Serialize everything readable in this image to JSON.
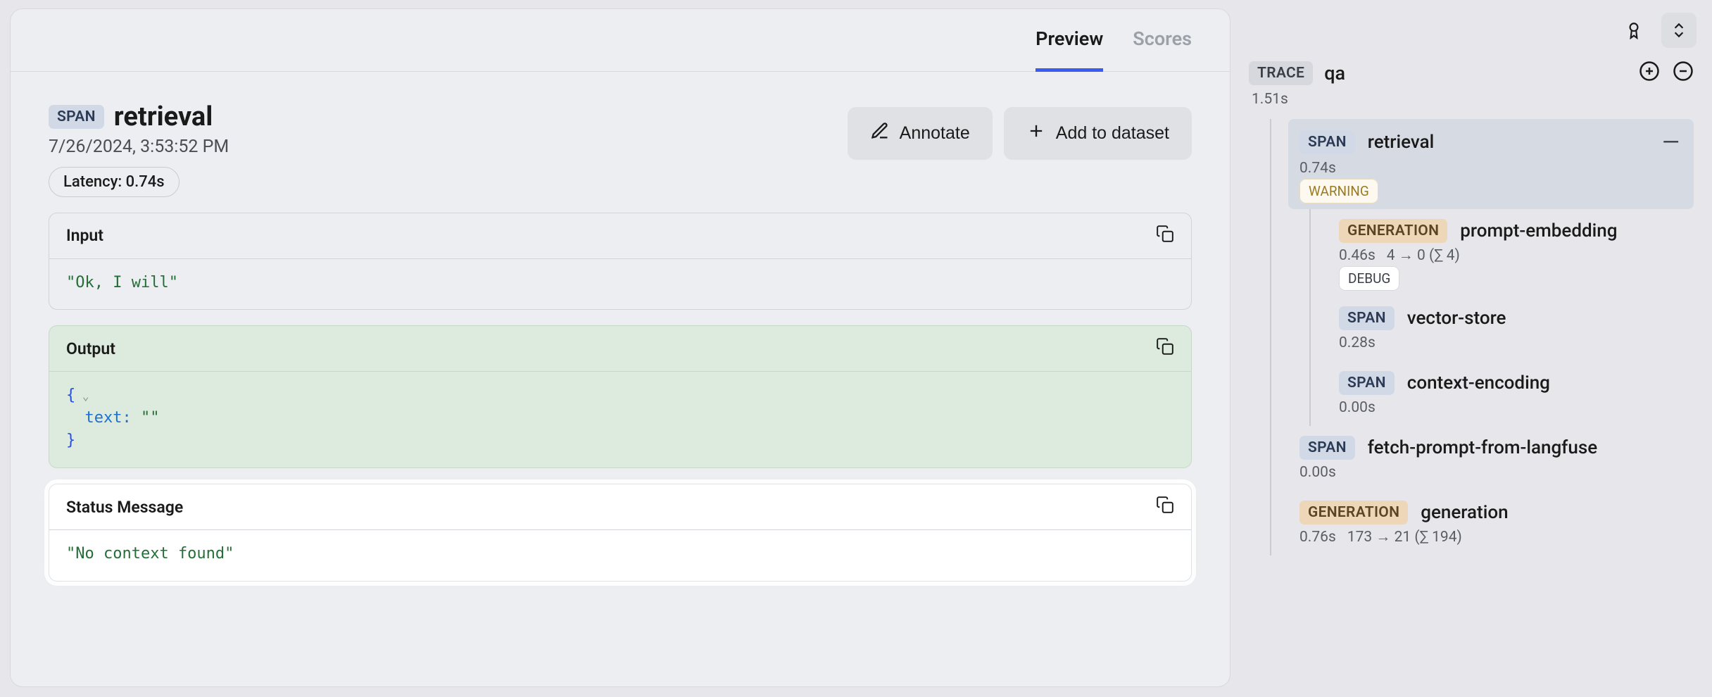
{
  "tabs": {
    "preview": "Preview",
    "scores": "Scores"
  },
  "detail": {
    "badge": "SPAN",
    "title": "retrieval",
    "timestamp": "7/26/2024, 3:53:52 PM",
    "latency_label": "Latency: 0.74s"
  },
  "actions": {
    "annotate": "Annotate",
    "add_to_dataset": "Add to dataset"
  },
  "boxes": {
    "input": {
      "label": "Input",
      "value": "\"Ok, I will\""
    },
    "output": {
      "label": "Output",
      "key": "text",
      "value": "\"\""
    },
    "status": {
      "label": "Status Message",
      "value": "\"No context found\""
    }
  },
  "trace": {
    "badge": "TRACE",
    "name": "qa",
    "duration": "1.51s"
  },
  "nodes": {
    "retrieval": {
      "badge": "SPAN",
      "name": "retrieval",
      "duration": "0.74s",
      "tag": "WARNING"
    },
    "prompt_embedding": {
      "badge": "GENERATION",
      "name": "prompt-embedding",
      "duration": "0.46s",
      "tokens": "4 → 0 (∑ 4)",
      "tag": "DEBUG"
    },
    "vector_store": {
      "badge": "SPAN",
      "name": "vector-store",
      "duration": "0.28s"
    },
    "context_encoding": {
      "badge": "SPAN",
      "name": "context-encoding",
      "duration": "0.00s"
    },
    "fetch_prompt": {
      "badge": "SPAN",
      "name": "fetch-prompt-from-langfuse",
      "duration": "0.00s"
    },
    "generation": {
      "badge": "GENERATION",
      "name": "generation",
      "duration": "0.76s",
      "tokens": "173 → 21 (∑ 194)"
    }
  }
}
